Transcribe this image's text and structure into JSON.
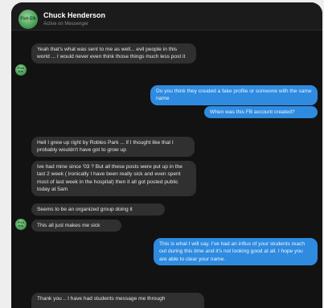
{
  "contact": {
    "name": "Chuck Henderson",
    "status": "Active on Messenger",
    "avatar_label": "Fish Elk"
  },
  "messages": [
    {
      "dir": "in",
      "text": "Yeah that's what was sent to me as well... evil people in this world ... I would never even think those things much less post it"
    },
    {
      "dir": "out",
      "text": "Do you think they created a fake profile or someone with the same name"
    },
    {
      "dir": "out",
      "text": "When was this FB account created?"
    },
    {
      "dir": "in",
      "text": "Hell I grew up right by Robles Park ... if I thought like that I probably wouldn't have got to grow up"
    },
    {
      "dir": "in",
      "text": "Ive had mine since '03 ? But all these posts were put up in the last 2 week ( ironically I have been really sick and even spent most of last week in the hospital) then it all got posted public today at 5am"
    },
    {
      "dir": "in",
      "text": "Seems to be an organized group doing it"
    },
    {
      "dir": "in",
      "text": "This all just makes me sick"
    },
    {
      "dir": "out",
      "text": "This is what I will say. I've had an influx of your students reach out during this time and it's not looking good at all. I hope you are able to clear your name."
    },
    {
      "dir": "in",
      "text": "Thank you .. I have had students message me through"
    }
  ],
  "colors": {
    "incoming_bubble": "#303030",
    "outgoing_bubble": "#2e8be0",
    "background": "#121212"
  }
}
